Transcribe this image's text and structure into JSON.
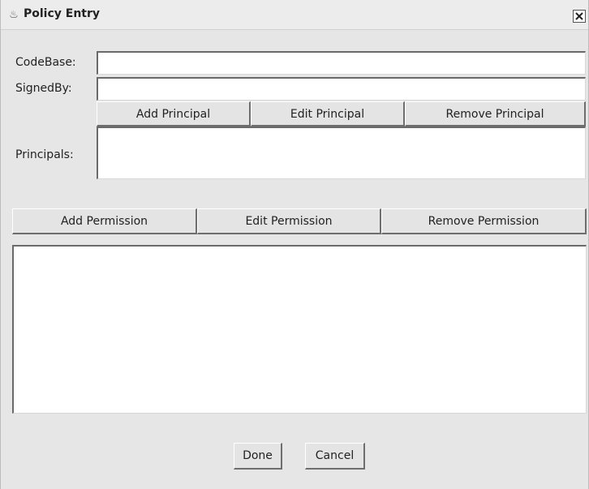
{
  "window": {
    "title": "Policy Entry",
    "icon": "java-cup-icon",
    "close_icon": "close-icon"
  },
  "form": {
    "codebase_label": "CodeBase:",
    "codebase_value": "",
    "signedby_label": "SignedBy:",
    "signedby_value": "",
    "principals_label": "Principals:"
  },
  "principal_buttons": {
    "add": "Add Principal",
    "edit": "Edit Principal",
    "remove": "Remove Principal"
  },
  "permission_buttons": {
    "add": "Add Permission",
    "edit": "Edit Permission",
    "remove": "Remove Permission"
  },
  "footer": {
    "done": "Done",
    "cancel": "Cancel"
  }
}
